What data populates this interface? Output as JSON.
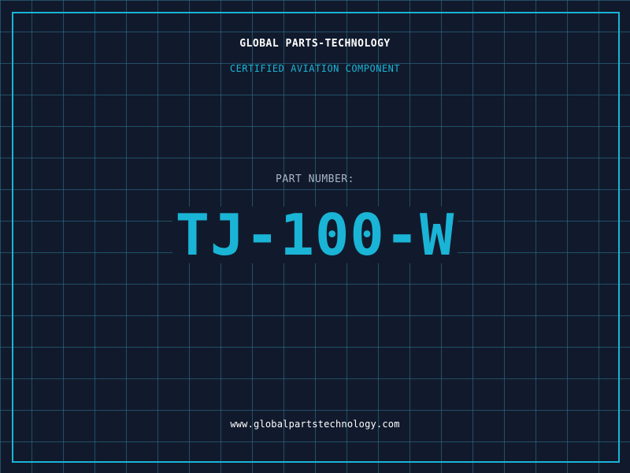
{
  "header": {
    "company": "GLOBAL PARTS-TECHNOLOGY",
    "tagline": "CERTIFIED AVIATION COMPONENT"
  },
  "part": {
    "label": "PART NUMBER:",
    "number": "TJ-100-W"
  },
  "footer": {
    "website": "www.globalpartstechnology.com"
  },
  "colors": {
    "background": "#111a2c",
    "grid": "#2e7896",
    "accent": "#1ab4d6",
    "text": "#ffffff",
    "muted": "#a7b4c7"
  }
}
